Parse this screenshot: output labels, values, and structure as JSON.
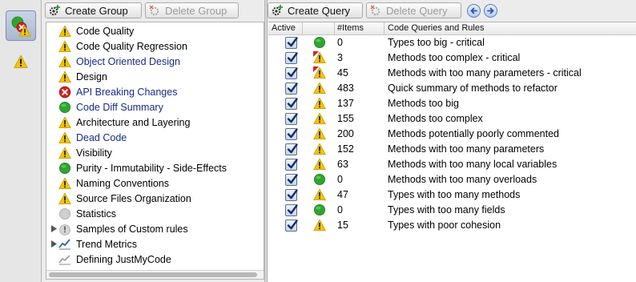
{
  "groups_toolbar": {
    "create_label": "Create Group",
    "delete_label": "Delete Group"
  },
  "queries_toolbar": {
    "create_label": "Create Query",
    "delete_label": "Delete Query"
  },
  "groups": [
    {
      "label": "Code Quality",
      "icon": "warning-icon",
      "blue": false,
      "disclosure": false
    },
    {
      "label": "Code Quality Regression",
      "icon": "warning-icon",
      "blue": false,
      "disclosure": false
    },
    {
      "label": "Object Oriented Design",
      "icon": "warning-icon",
      "blue": true,
      "disclosure": false
    },
    {
      "label": "Design",
      "icon": "warning-icon",
      "blue": false,
      "disclosure": false
    },
    {
      "label": "API Breaking Changes",
      "icon": "error-icon",
      "blue": true,
      "disclosure": false
    },
    {
      "label": "Code Diff Summary",
      "icon": "ok-icon",
      "blue": true,
      "disclosure": false
    },
    {
      "label": "Architecture and Layering",
      "icon": "warning-icon",
      "blue": false,
      "disclosure": false
    },
    {
      "label": "Dead Code",
      "icon": "warning-icon",
      "blue": true,
      "disclosure": false
    },
    {
      "label": "Visibility",
      "icon": "warning-icon",
      "blue": false,
      "disclosure": false
    },
    {
      "label": "Purity - Immutability - Side-Effects",
      "icon": "ok-icon",
      "blue": false,
      "disclosure": false
    },
    {
      "label": "Naming Conventions",
      "icon": "warning-icon",
      "blue": false,
      "disclosure": false
    },
    {
      "label": "Source Files Organization",
      "icon": "warning-icon",
      "blue": false,
      "disclosure": false
    },
    {
      "label": "Statistics",
      "icon": "gray-circle-icon",
      "blue": false,
      "disclosure": false
    },
    {
      "label": "Samples of Custom rules",
      "icon": "gray-warning-icon",
      "blue": false,
      "disclosure": true
    },
    {
      "label": "Trend Metrics",
      "icon": "trend-chart-icon",
      "blue": false,
      "disclosure": true
    },
    {
      "label": "Defining JustMyCode",
      "icon": "trend-chart-gray-icon",
      "blue": false,
      "disclosure": false
    }
  ],
  "table_headers": {
    "active": "Active",
    "items": "#Items",
    "name": "Code Queries and Rules"
  },
  "queries": [
    {
      "count": "0",
      "name": "Types too big - critical",
      "icon": "ok-icon"
    },
    {
      "count": "3",
      "name": "Methods too complex - critical",
      "icon": "critical-warning-icon"
    },
    {
      "count": "45",
      "name": "Methods with too many parameters - critical",
      "icon": "critical-warning-icon"
    },
    {
      "count": "483",
      "name": "Quick summary of methods to refactor",
      "icon": "warning-icon"
    },
    {
      "count": "137",
      "name": "Methods too big",
      "icon": "warning-icon"
    },
    {
      "count": "155",
      "name": "Methods too complex",
      "icon": "warning-icon"
    },
    {
      "count": "200",
      "name": "Methods potentially poorly commented",
      "icon": "warning-icon"
    },
    {
      "count": "152",
      "name": "Methods with too many parameters",
      "icon": "warning-icon"
    },
    {
      "count": "63",
      "name": "Methods with too many local variables",
      "icon": "warning-icon"
    },
    {
      "count": "0",
      "name": "Methods with too many overloads",
      "icon": "ok-icon"
    },
    {
      "count": "47",
      "name": "Types with too many methods",
      "icon": "warning-icon"
    },
    {
      "count": "0",
      "name": "Types with too many fields",
      "icon": "ok-icon"
    },
    {
      "count": "15",
      "name": "Types with poor cohesion",
      "icon": "warning-icon"
    }
  ],
  "colors": {
    "warning": "#f5c400",
    "error": "#d42020",
    "ok": "#2fa52f",
    "group_link": "#1a2a8c"
  }
}
